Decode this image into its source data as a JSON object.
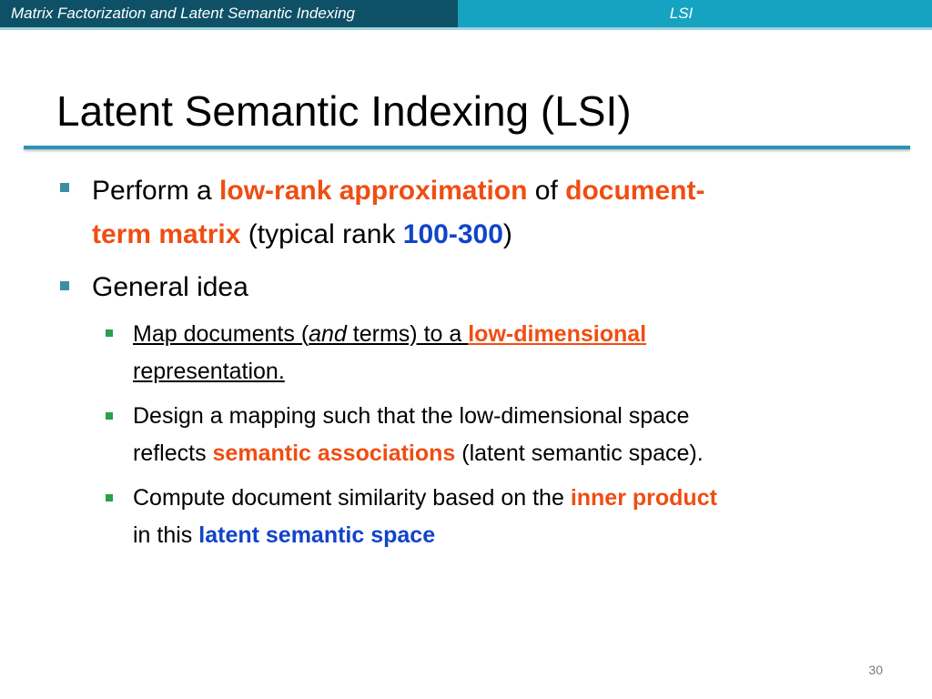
{
  "header": {
    "section": "Matrix Factorization and Latent Semantic Indexing",
    "topic": "LSI"
  },
  "slide": {
    "title": "Latent Semantic Indexing (LSI)",
    "page_number": "30"
  },
  "bullets": {
    "b1": {
      "perform": "Perform a ",
      "low_rank": "low-rank approximation",
      "of": " of ",
      "doc_term_1": "document-",
      "doc_term_2": "term matrix",
      "typical": " (typical rank ",
      "rank": "100-300",
      "close": ")"
    },
    "b2": {
      "text": "General idea"
    },
    "s1": {
      "map": "Map documents (",
      "and": "and",
      "terms": " terms) to a ",
      "low_dim": "low-dimensional",
      "repr": "representation."
    },
    "s2": {
      "line1": "Design a mapping such that the low-dimensional space",
      "reflects": "reflects ",
      "sem_assoc": "semantic associations",
      "latent": " (latent semantic space)."
    },
    "s3": {
      "compute": "Compute document similarity based on the ",
      "inner": "inner product",
      "in_this": "in this ",
      "latent_space": "latent semantic space"
    }
  },
  "colors": {
    "header_dark": "#0e5166",
    "header_light": "#16a3c1",
    "highlight_red": "#f04d12",
    "highlight_blue": "#1144c8",
    "title_rule": "#2b93b5"
  }
}
